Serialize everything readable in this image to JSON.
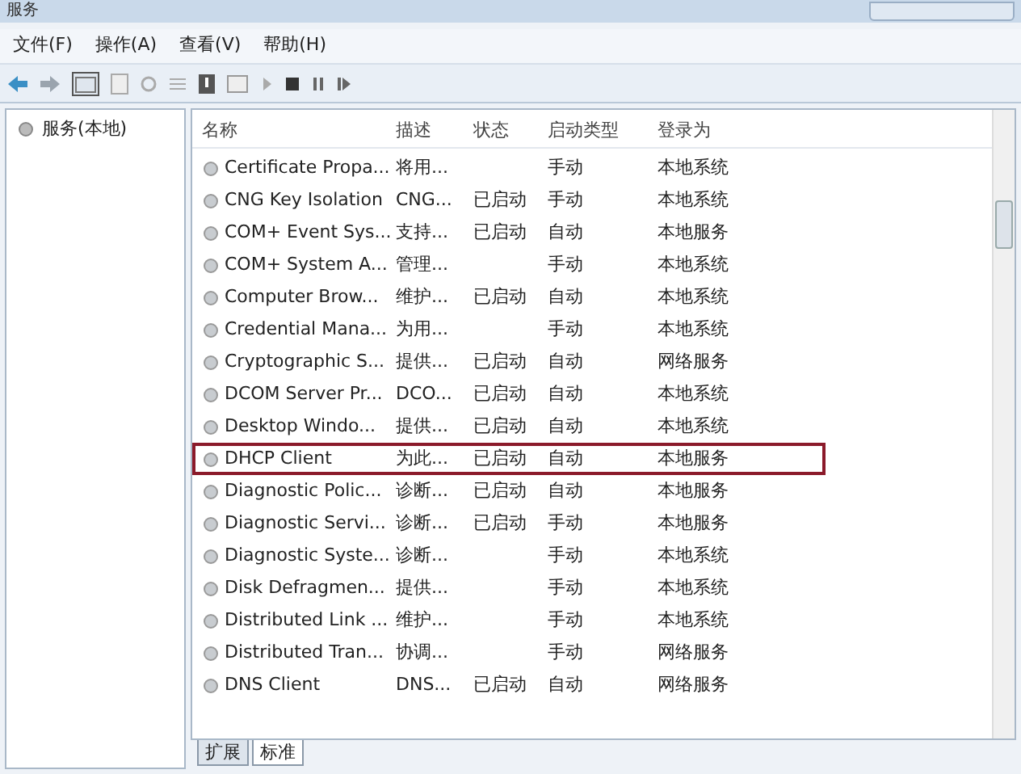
{
  "window": {
    "title": "服务"
  },
  "menu": [
    "文件(F)",
    "操作(A)",
    "查看(V)",
    "帮助(H)"
  ],
  "tree": {
    "items": [
      {
        "label": "服务(本地)",
        "selected": false
      }
    ]
  },
  "table": {
    "columns": [
      "名称",
      "描述",
      "状态",
      "启动类型",
      "登录为"
    ],
    "rows": [
      {
        "cells": [
          "Certificate Propa...",
          "将用...",
          "",
          "手动",
          "本地系统"
        ],
        "highlighted": false
      },
      {
        "cells": [
          "CNG Key Isolation",
          "CNG...",
          "已启动",
          "手动",
          "本地系统"
        ],
        "highlighted": false
      },
      {
        "cells": [
          "COM+ Event Sys...",
          "支持...",
          "已启动",
          "自动",
          "本地服务"
        ],
        "highlighted": false
      },
      {
        "cells": [
          "COM+ System A...",
          "管理...",
          "",
          "手动",
          "本地系统"
        ],
        "highlighted": false
      },
      {
        "cells": [
          "Computer Brow...",
          "维护...",
          "已启动",
          "自动",
          "本地系统"
        ],
        "highlighted": false
      },
      {
        "cells": [
          "Credential Mana...",
          "为用...",
          "",
          "手动",
          "本地系统"
        ],
        "highlighted": false
      },
      {
        "cells": [
          "Cryptographic S...",
          "提供...",
          "已启动",
          "自动",
          "网络服务"
        ],
        "highlighted": false
      },
      {
        "cells": [
          "DCOM Server Pr...",
          "DCO...",
          "已启动",
          "自动",
          "本地系统"
        ],
        "highlighted": false
      },
      {
        "cells": [
          "Desktop Windo...",
          "提供...",
          "已启动",
          "自动",
          "本地系统"
        ],
        "highlighted": false
      },
      {
        "cells": [
          "DHCP Client",
          "为此...",
          "已启动",
          "自动",
          "本地服务"
        ],
        "highlighted": true
      },
      {
        "cells": [
          "Diagnostic Polic...",
          "诊断...",
          "已启动",
          "自动",
          "本地服务"
        ],
        "highlighted": false
      },
      {
        "cells": [
          "Diagnostic Servi...",
          "诊断...",
          "已启动",
          "手动",
          "本地服务"
        ],
        "highlighted": false
      },
      {
        "cells": [
          "Diagnostic Syste...",
          "诊断...",
          "",
          "手动",
          "本地系统"
        ],
        "highlighted": false
      },
      {
        "cells": [
          "Disk Defragmen...",
          "提供...",
          "",
          "手动",
          "本地系统"
        ],
        "highlighted": false
      },
      {
        "cells": [
          "Distributed Link ...",
          "维护...",
          "",
          "手动",
          "本地系统"
        ],
        "highlighted": false
      },
      {
        "cells": [
          "Distributed Tran...",
          "协调...",
          "",
          "手动",
          "网络服务"
        ],
        "highlighted": false
      },
      {
        "cells": [
          "DNS Client",
          "DNS...",
          "已启动",
          "自动",
          "网络服务"
        ],
        "highlighted": false
      }
    ]
  },
  "tabs": [
    {
      "label": "扩展",
      "selected": false
    },
    {
      "label": "标准",
      "selected": true
    }
  ]
}
